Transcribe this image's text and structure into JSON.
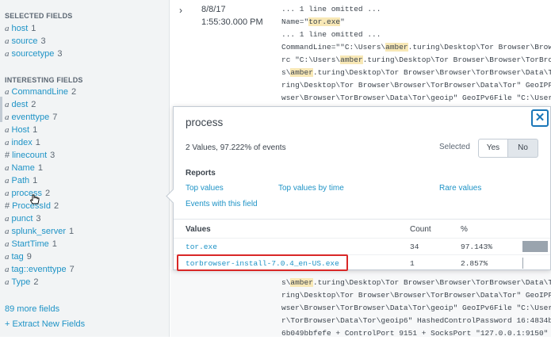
{
  "sidebar": {
    "selected_title": "SELECTED FIELDS",
    "selected": [
      {
        "type": "a",
        "name": "host",
        "count": "1"
      },
      {
        "type": "a",
        "name": "source",
        "count": "3"
      },
      {
        "type": "a",
        "name": "sourcetype",
        "count": "3"
      }
    ],
    "interesting_title": "INTERESTING FIELDS",
    "interesting": [
      {
        "type": "a",
        "name": "CommandLine",
        "count": "2"
      },
      {
        "type": "a",
        "name": "dest",
        "count": "2"
      },
      {
        "type": "a",
        "name": "eventtype",
        "count": "7"
      },
      {
        "type": "a",
        "name": "Host",
        "count": "1"
      },
      {
        "type": "a",
        "name": "index",
        "count": "1"
      },
      {
        "type": "#",
        "name": "linecount",
        "count": "3"
      },
      {
        "type": "a",
        "name": "Name",
        "count": "1"
      },
      {
        "type": "a",
        "name": "Path",
        "count": "1"
      },
      {
        "type": "a",
        "name": "process",
        "count": "2"
      },
      {
        "type": "#",
        "name": "ProcessId",
        "count": "2"
      },
      {
        "type": "a",
        "name": "punct",
        "count": "3"
      },
      {
        "type": "a",
        "name": "splunk_server",
        "count": "1"
      },
      {
        "type": "a",
        "name": "StartTime",
        "count": "1"
      },
      {
        "type": "a",
        "name": "tag",
        "count": "9"
      },
      {
        "type": "a",
        "name": "tag::eventtype",
        "count": "7"
      },
      {
        "type": "a",
        "name": "Type",
        "count": "2"
      }
    ],
    "more_fields": "89 more fields",
    "extract_fields": "+ Extract New Fields"
  },
  "event": {
    "date": "8/8/17",
    "time": "1:55:30.000 PM"
  },
  "popover": {
    "title": "process",
    "stats": "2 Values, 97.222% of events",
    "selected_label": "Selected",
    "yes_label": "Yes",
    "no_label": "No",
    "reports_title": "Reports",
    "report_links": {
      "top_values": "Top values",
      "top_by_time": "Top values by time",
      "rare_values": "Rare values",
      "events_with_field": "Events with this field"
    },
    "columns": {
      "values": "Values",
      "count": "Count",
      "percent": "%"
    },
    "rows": [
      {
        "value": "tor.exe",
        "count": "34",
        "percent": "97.143%",
        "fraction": 0.97143
      },
      {
        "value": "torbrowser-install-7.0.4_en-US.exe",
        "count": "1",
        "percent": "2.857%",
        "fraction": 0.02857
      }
    ],
    "close_icon": "close-icon"
  },
  "colors": {
    "link": "#1e93c6",
    "highlight": "#f8e8b6",
    "callout_border": "#d92727",
    "close_border": "#1a77b8"
  }
}
